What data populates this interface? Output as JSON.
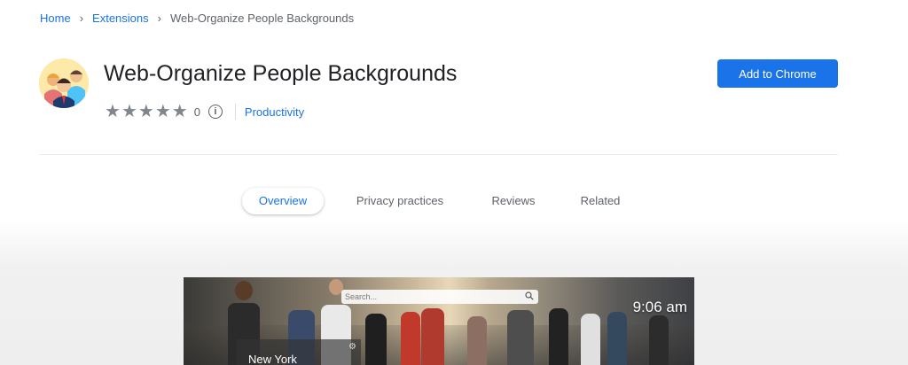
{
  "breadcrumb": {
    "home": "Home",
    "extensions": "Extensions",
    "current": "Web-Organize People Backgrounds",
    "separator": "›"
  },
  "extension": {
    "title": "Web-Organize People Backgrounds",
    "rating_count": "0",
    "stars_filled": 0,
    "stars_total": 5,
    "category": "Productivity",
    "install_button": "Add to Chrome"
  },
  "tabs": [
    {
      "label": "Overview",
      "active": true
    },
    {
      "label": "Privacy practices",
      "active": false
    },
    {
      "label": "Reviews",
      "active": false
    },
    {
      "label": "Related",
      "active": false
    }
  ],
  "preview": {
    "search_placeholder": "Search...",
    "clock": "9:06 am",
    "city": "New York"
  },
  "colors": {
    "accent": "#1a73e8",
    "text": "#202124",
    "muted": "#5f6368",
    "star": "#80868b"
  },
  "icons": {
    "breadcrumb_separator": "chevron-right-icon",
    "rating": "star-icon",
    "info": "info-icon",
    "search": "search-icon",
    "settings": "gear-icon"
  }
}
